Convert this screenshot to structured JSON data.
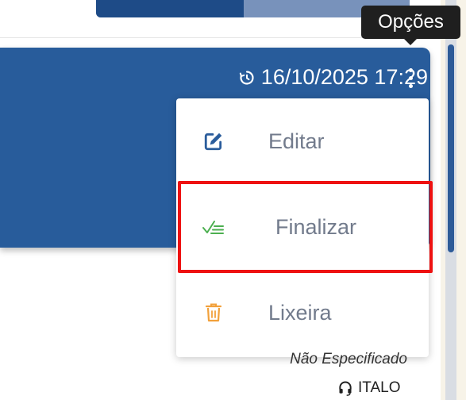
{
  "tooltip": {
    "text": "Opções"
  },
  "card": {
    "datetime": "16/10/2025 17:29",
    "time_icon": "history-icon",
    "menu_icon": "more-vertical-icon"
  },
  "menu": {
    "items": [
      {
        "label": "Editar",
        "icon": "edit-icon",
        "color": "#2b5d9c"
      },
      {
        "label": "Finalizar",
        "icon": "check-list-icon",
        "color": "#4caf50"
      },
      {
        "label": "Lixeira",
        "icon": "trash-icon",
        "color": "#f2a13b"
      }
    ],
    "highlighted": "Finalizar"
  },
  "footer": {
    "unspecified": "Não Especificado",
    "agent_icon": "headset-icon",
    "agent": "ITALO"
  },
  "colors": {
    "card": "#285c9b",
    "progress_fill": "#1e4b87",
    "progress_track": "#7892bb",
    "highlight": "#ee1111"
  },
  "progress": {
    "fraction": 0.47
  }
}
